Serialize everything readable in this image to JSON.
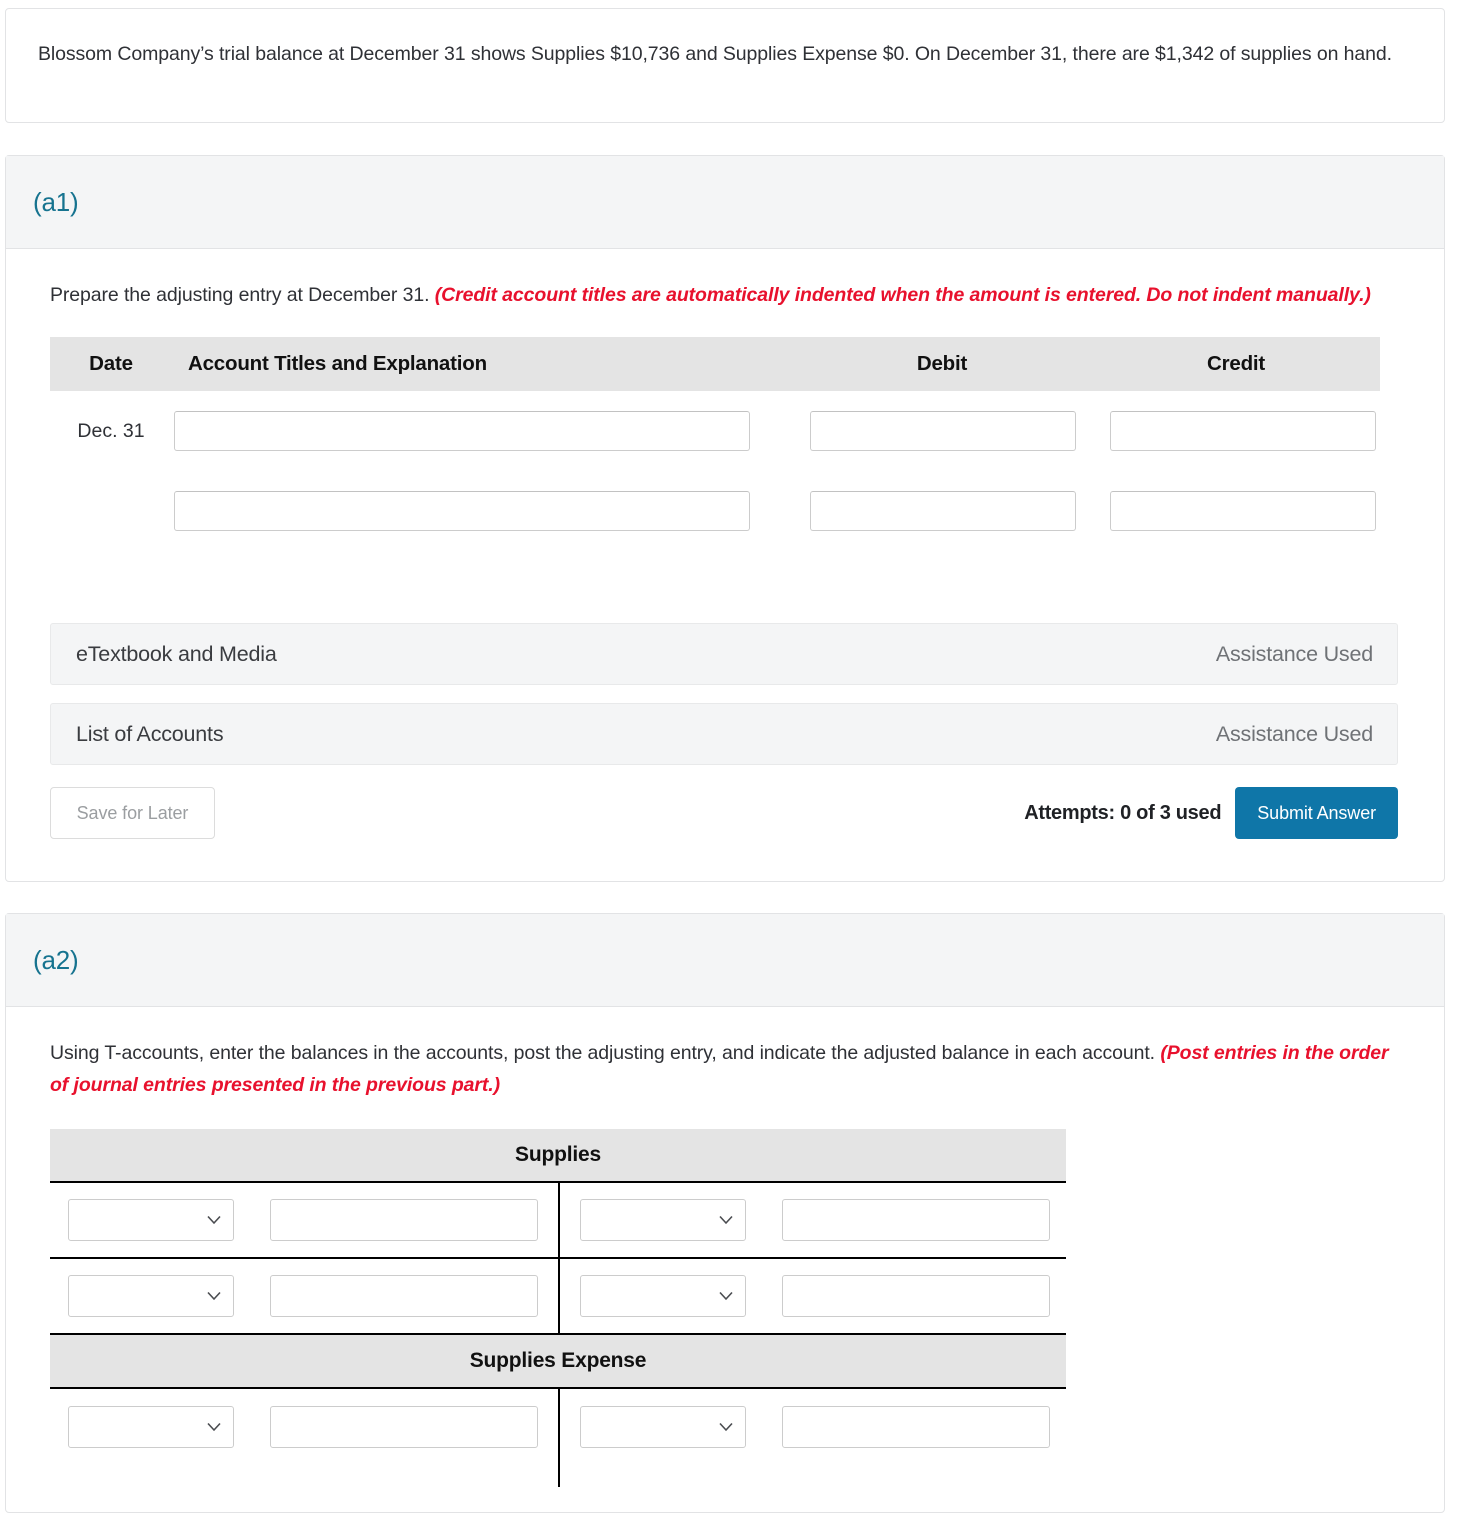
{
  "problem": {
    "text": "Blossom Company’s trial balance at December 31 shows Supplies $10,736 and Supplies Expense $0. On December 31, there are $1,342 of supplies on hand."
  },
  "part_a1": {
    "label": "(a1)",
    "instruction_plain": "Prepare the adjusting entry at December 31. ",
    "instruction_emphasis": "(Credit account titles are automatically indented when the amount is entered. Do not indent manually.)",
    "journal_table": {
      "headers": {
        "date": "Date",
        "account": "Account Titles and Explanation",
        "debit": "Debit",
        "credit": "Credit"
      },
      "rows": [
        {
          "date": "Dec. 31",
          "account_value": "",
          "account_placeholder": "",
          "debit_value": "",
          "credit_value": ""
        },
        {
          "date": "",
          "account_value": "",
          "account_placeholder": "",
          "debit_value": "",
          "credit_value": ""
        }
      ]
    },
    "assistance": [
      {
        "label": "eTextbook and Media",
        "status": "Assistance Used"
      },
      {
        "label": "List of Accounts",
        "status": "Assistance Used"
      }
    ],
    "actions": {
      "save_label": "Save for Later",
      "attempts_text": "Attempts: 0 of 3 used",
      "submit_label": "Submit Answer"
    }
  },
  "part_a2": {
    "label": "(a2)",
    "instruction_plain": "Using T-accounts, enter the balances in the accounts, post the adjusting entry, and indicate the adjusted balance in each account. ",
    "instruction_emphasis": "(Post entries in the order of journal entries presented in the previous part.)",
    "taccounts": [
      {
        "title": "Supplies",
        "rows": [
          {
            "left_select": "",
            "left_amount": "",
            "right_select": "",
            "right_amount": ""
          },
          {
            "left_select": "",
            "left_amount": "",
            "right_select": "",
            "right_amount": ""
          }
        ]
      },
      {
        "title": "Supplies Expense",
        "rows": [
          {
            "left_select": "",
            "left_amount": "",
            "right_select": "",
            "right_amount": ""
          }
        ]
      }
    ]
  },
  "colors": {
    "accent_blue": "#16738f",
    "submit_blue": "#0f76a8",
    "emphasis_red": "#e8112d",
    "header_gray": "#e4e4e4",
    "panel_gray": "#f4f5f6"
  },
  "icons": {
    "chevron_down": "chevron-down-icon"
  }
}
